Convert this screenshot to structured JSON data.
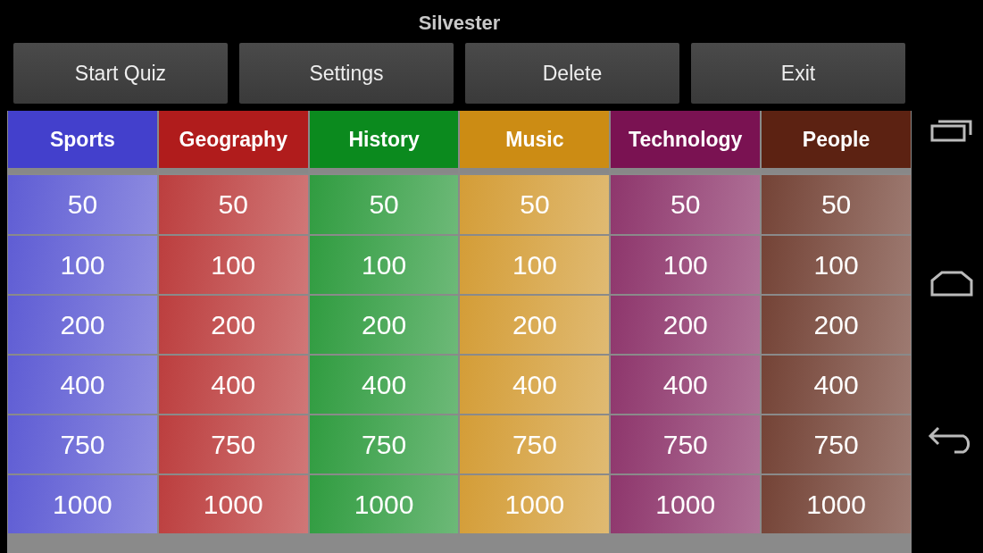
{
  "title": "Silvester",
  "buttons": [
    "Start Quiz",
    "Settings",
    "Delete",
    "Exit"
  ],
  "categories": [
    {
      "name": "Sports",
      "color": "#4340cc",
      "values": [
        "50",
        "100",
        "200",
        "400",
        "750",
        "1000"
      ]
    },
    {
      "name": "Geography",
      "color": "#b01c1c",
      "values": [
        "50",
        "100",
        "200",
        "400",
        "750",
        "1000"
      ]
    },
    {
      "name": "History",
      "color": "#0b8a1e",
      "values": [
        "50",
        "100",
        "200",
        "400",
        "750",
        "1000"
      ]
    },
    {
      "name": "Music",
      "color": "#cc8c14",
      "values": [
        "50",
        "100",
        "200",
        "400",
        "750",
        "1000"
      ]
    },
    {
      "name": "Technology",
      "color": "#7a1252",
      "values": [
        "50",
        "100",
        "200",
        "400",
        "750",
        "1000"
      ]
    },
    {
      "name": "People",
      "color": "#5c2212",
      "values": [
        "50",
        "100",
        "200",
        "400",
        "750",
        "1000"
      ]
    }
  ]
}
